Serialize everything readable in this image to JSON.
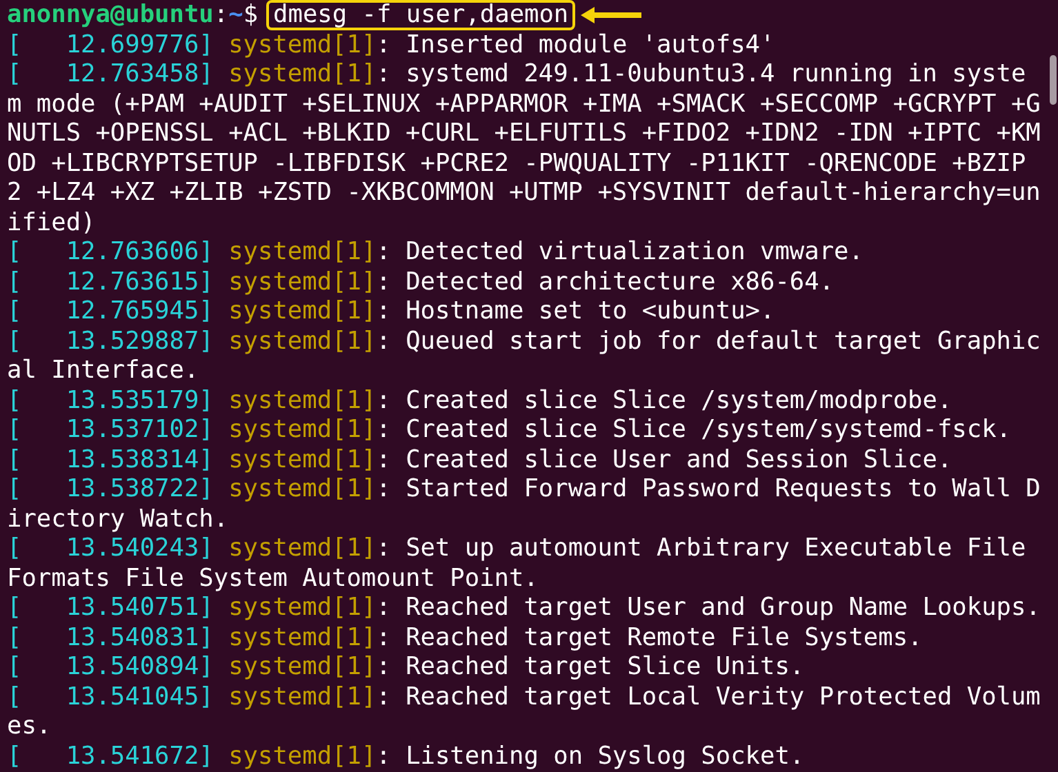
{
  "prompt": {
    "user_host": "anonnya@ubuntu",
    "separator": ":",
    "path": "~",
    "symbol": "$",
    "command": "dmesg -f user,daemon",
    "highlighted": true
  },
  "log": [
    {
      "timestamp": "[   12.699776]",
      "source": "systemd[1]",
      "message": ": Inserted module 'autofs4'"
    },
    {
      "timestamp": "[   12.763458]",
      "source": "systemd[1]",
      "message": ": systemd 249.11-0ubuntu3.4 running in system mode (+PAM +AUDIT +SELINUX +APPARMOR +IMA +SMACK +SECCOMP +GCRYPT +GNUTLS +OPENSSL +ACL +BLKID +CURL +ELFUTILS +FIDO2 +IDN2 -IDN +IPTC +KMOD +LIBCRYPTSETUP -LIBFDISK +PCRE2 -PWQUALITY -P11KIT -QRENCODE +BZIP2 +LZ4 +XZ +ZLIB +ZSTD -XKBCOMMON +UTMP +SYSVINIT default-hierarchy=unified)"
    },
    {
      "timestamp": "[   12.763606]",
      "source": "systemd[1]",
      "message": ": Detected virtualization vmware."
    },
    {
      "timestamp": "[   12.763615]",
      "source": "systemd[1]",
      "message": ": Detected architecture x86-64."
    },
    {
      "timestamp": "[   12.765945]",
      "source": "systemd[1]",
      "message": ": Hostname set to <ubuntu>."
    },
    {
      "timestamp": "[   13.529887]",
      "source": "systemd[1]",
      "message": ": Queued start job for default target Graphical Interface."
    },
    {
      "timestamp": "[   13.535179]",
      "source": "systemd[1]",
      "message": ": Created slice Slice /system/modprobe."
    },
    {
      "timestamp": "[   13.537102]",
      "source": "systemd[1]",
      "message": ": Created slice Slice /system/systemd-fsck."
    },
    {
      "timestamp": "[   13.538314]",
      "source": "systemd[1]",
      "message": ": Created slice User and Session Slice."
    },
    {
      "timestamp": "[   13.538722]",
      "source": "systemd[1]",
      "message": ": Started Forward Password Requests to Wall Directory Watch."
    },
    {
      "timestamp": "[   13.540243]",
      "source": "systemd[1]",
      "message": ": Set up automount Arbitrary Executable File Formats File System Automount Point."
    },
    {
      "timestamp": "[   13.540751]",
      "source": "systemd[1]",
      "message": ": Reached target User and Group Name Lookups."
    },
    {
      "timestamp": "[   13.540831]",
      "source": "systemd[1]",
      "message": ": Reached target Remote File Systems."
    },
    {
      "timestamp": "[   13.540894]",
      "source": "systemd[1]",
      "message": ": Reached target Slice Units."
    },
    {
      "timestamp": "[   13.541045]",
      "source": "systemd[1]",
      "message": ": Reached target Local Verity Protected Volumes."
    },
    {
      "timestamp": "[   13.541672]",
      "source": "systemd[1]",
      "message": ": Listening on Syslog Socket."
    }
  ]
}
